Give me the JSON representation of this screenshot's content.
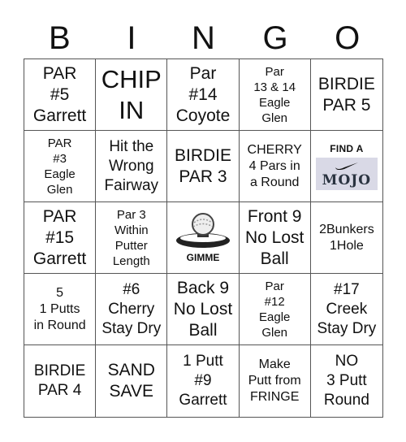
{
  "header": [
    "B",
    "I",
    "N",
    "G",
    "O"
  ],
  "cells": [
    {
      "text": "PAR\n#5\nGarrett",
      "size": "s-l"
    },
    {
      "text": "CHIP\nIN",
      "size": "s-xl"
    },
    {
      "text": "Par\n#14\nCoyote",
      "size": "s-l"
    },
    {
      "text": "Par\n13 & 14\nEagle\nGlen",
      "size": "s-xs"
    },
    {
      "text": "BIRDIE\nPAR 5",
      "size": "s-l"
    },
    {
      "text": "PAR\n#3\nEagle\nGlen",
      "size": "s-xs"
    },
    {
      "text": "Hit the\nWrong\nFairway",
      "size": "s-m"
    },
    {
      "text": "BIRDIE\nPAR 3",
      "size": "s-l"
    },
    {
      "text": "CHERRY\n4 Pars in\na Round",
      "size": "s-s"
    },
    {
      "image": "mojo",
      "label": "FIND A",
      "image_text": "MOJO",
      "icon": "swoosh-icon"
    },
    {
      "text": "PAR\n#15\nGarrett",
      "size": "s-l"
    },
    {
      "text": "Par 3\nWithin\nPutter\nLength",
      "size": "s-xs"
    },
    {
      "image": "gimme",
      "label": "GIMME",
      "icon": "golf-ball-on-hole-icon"
    },
    {
      "text": "Front 9\nNo Lost\nBall",
      "size": "s-l"
    },
    {
      "text": "2Bunkers\n1Hole",
      "size": "s-s"
    },
    {
      "text": "5\n1 Putts\nin Round",
      "size": "s-s"
    },
    {
      "text": "#6\nCherry\nStay Dry",
      "size": "s-m"
    },
    {
      "text": "Back 9\nNo Lost\nBall",
      "size": "s-l"
    },
    {
      "text": "Par\n#12\nEagle\nGlen",
      "size": "s-xs"
    },
    {
      "text": "#17\nCreek\nStay Dry",
      "size": "s-m"
    },
    {
      "text": "BIRDIE\nPAR 4",
      "size": "s-m"
    },
    {
      "text": "SAND\nSAVE",
      "size": "s-l"
    },
    {
      "text": "1 Putt\n#9\nGarrett",
      "size": "s-m"
    },
    {
      "text": "Make\nPutt from\nFRINGE",
      "size": "s-s"
    },
    {
      "text": "NO\n3 Putt\nRound",
      "size": "s-m"
    }
  ]
}
